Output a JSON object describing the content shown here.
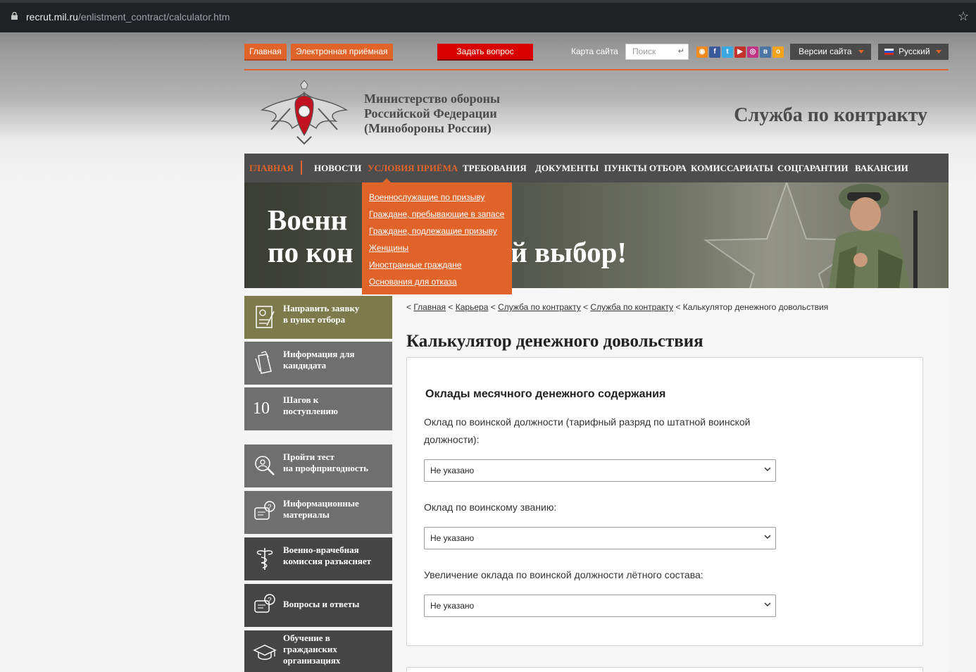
{
  "browser": {
    "url_domain": "recrut.mil.ru",
    "url_path": "/enlistment_contract/calculator.htm"
  },
  "topbar": {
    "home_label": "Главная",
    "reception_label": "Электронная приёмная",
    "ask_label": "Задать вопрос",
    "sitemap_label": "Карта сайта",
    "search_placeholder": "Поиск",
    "versions_label": "Версии сайта",
    "language_label": "Русский",
    "social_icons": [
      "rss-icon",
      "facebook-icon",
      "twitter-icon",
      "youtube-icon",
      "instagram-icon",
      "vk-icon",
      "odnoklassniki-icon"
    ]
  },
  "header": {
    "ministry_line1": "Министерство обороны",
    "ministry_line2": "Российской Федерации",
    "ministry_line3": "(Минобороны России)",
    "service_title": "Служба по контракту"
  },
  "nav": {
    "items": [
      {
        "label": "ГЛАВНАЯ"
      },
      {
        "label": "НОВОСТИ"
      },
      {
        "label": "УСЛОВИЯ ПРИЁМА"
      },
      {
        "label": "ТРЕБОВАНИЯ"
      },
      {
        "label": "ДОКУМЕНТЫ"
      },
      {
        "label": "ПУНКТЫ ОТБОРА"
      },
      {
        "label": "КОМИССАРИАТЫ"
      },
      {
        "label": "СОЦГАРАНТИИ"
      },
      {
        "label": "ВАКАНСИИ"
      }
    ]
  },
  "banner": {
    "line1": "Военн",
    "line1_tail": "",
    "line2": "по кон",
    "line2_tail": "ой выбор!"
  },
  "dropdown": {
    "items": [
      {
        "label": "Военнослужащие по призыву"
      },
      {
        "label": "Граждане, пребывающие в запасе"
      },
      {
        "label": "Граждане, подлежащие призыву"
      },
      {
        "label": "Женщины"
      },
      {
        "label": "Иностранные граждане"
      },
      {
        "label": "Основания для отказа"
      }
    ]
  },
  "sidebar": {
    "items": [
      {
        "line1": "Направить заявку",
        "line2": "в пункт отбора",
        "color": "#7d7b4c"
      },
      {
        "line1": "Информация для",
        "line2": "кандидата",
        "color": "#6f6f6f"
      },
      {
        "line1": "Шагов к",
        "line2": "поступлению",
        "color": "#6f6f6f"
      },
      {
        "line1": "Пройти тест",
        "line2": "на профпригодность",
        "color": "#6f6f6f"
      },
      {
        "line1": "Информационные",
        "line2": "материалы",
        "color": "#6f6f6f"
      },
      {
        "line1": "Военно-врачебная",
        "line2": "комиссия разъясняет",
        "color": "#454545"
      },
      {
        "line1": "Вопросы и ответы",
        "line2": "",
        "color": "#454545"
      },
      {
        "line1": "Обучение в",
        "line2": "гражданских",
        "line3": "организациях",
        "color": "#454545"
      }
    ]
  },
  "breadcrumb": {
    "home": "Главная",
    "career": "Карьера",
    "contract1": "Служба по контракту",
    "contract2": "Служба по контракту",
    "current": "Калькулятор денежного довольствия",
    "separator": "<"
  },
  "main": {
    "page_title": "Калькулятор денежного довольствия",
    "card_title": "Оклады месячного денежного содержания",
    "fields": [
      {
        "label": "Оклад по воинской должности (тарифный разряд по штатной воинской должности):",
        "value": "Не указано"
      },
      {
        "label": "Оклад по воинскому званию:",
        "value": "Не указано"
      },
      {
        "label": "Увеличение оклада по воинской должности лётного состава:",
        "value": "Не указано"
      }
    ]
  }
}
